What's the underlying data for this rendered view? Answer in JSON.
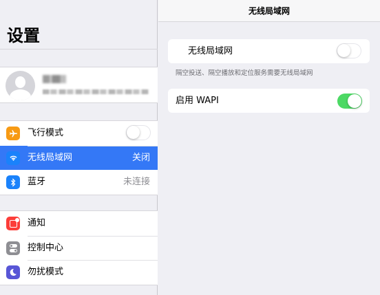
{
  "sidebar": {
    "title": "设置",
    "profile": {
      "name": "",
      "subtitle": ""
    },
    "groups": [
      {
        "items": [
          {
            "label": "飞行模式",
            "icon": "airplane-icon",
            "color": "#f79a14",
            "toggle": "off"
          },
          {
            "label": "无线局域网",
            "value": "关闭",
            "icon": "wifi-icon",
            "color": "#1a82fb",
            "selected": true
          },
          {
            "label": "蓝牙",
            "value": "未连接",
            "icon": "bluetooth-icon",
            "color": "#1a82fb"
          }
        ]
      },
      {
        "items": [
          {
            "label": "通知",
            "icon": "notifications-icon",
            "color": "#fc3d39"
          },
          {
            "label": "控制中心",
            "icon": "control-center-icon",
            "color": "#8e8e93"
          },
          {
            "label": "勿扰模式",
            "icon": "moon-icon",
            "color": "#5856d6"
          }
        ]
      }
    ]
  },
  "detail": {
    "title": "无线局域网",
    "wifi": {
      "label": "无线局域网",
      "toggle": "off"
    },
    "footnote": "隔空投送、隔空播放和定位服务需要无线局域网",
    "wapi": {
      "label": "启用 WAPI",
      "toggle": "on"
    }
  },
  "colors": {
    "accent": "#3478f6",
    "toggle_on": "#4cd964",
    "background": "#efeff4"
  }
}
